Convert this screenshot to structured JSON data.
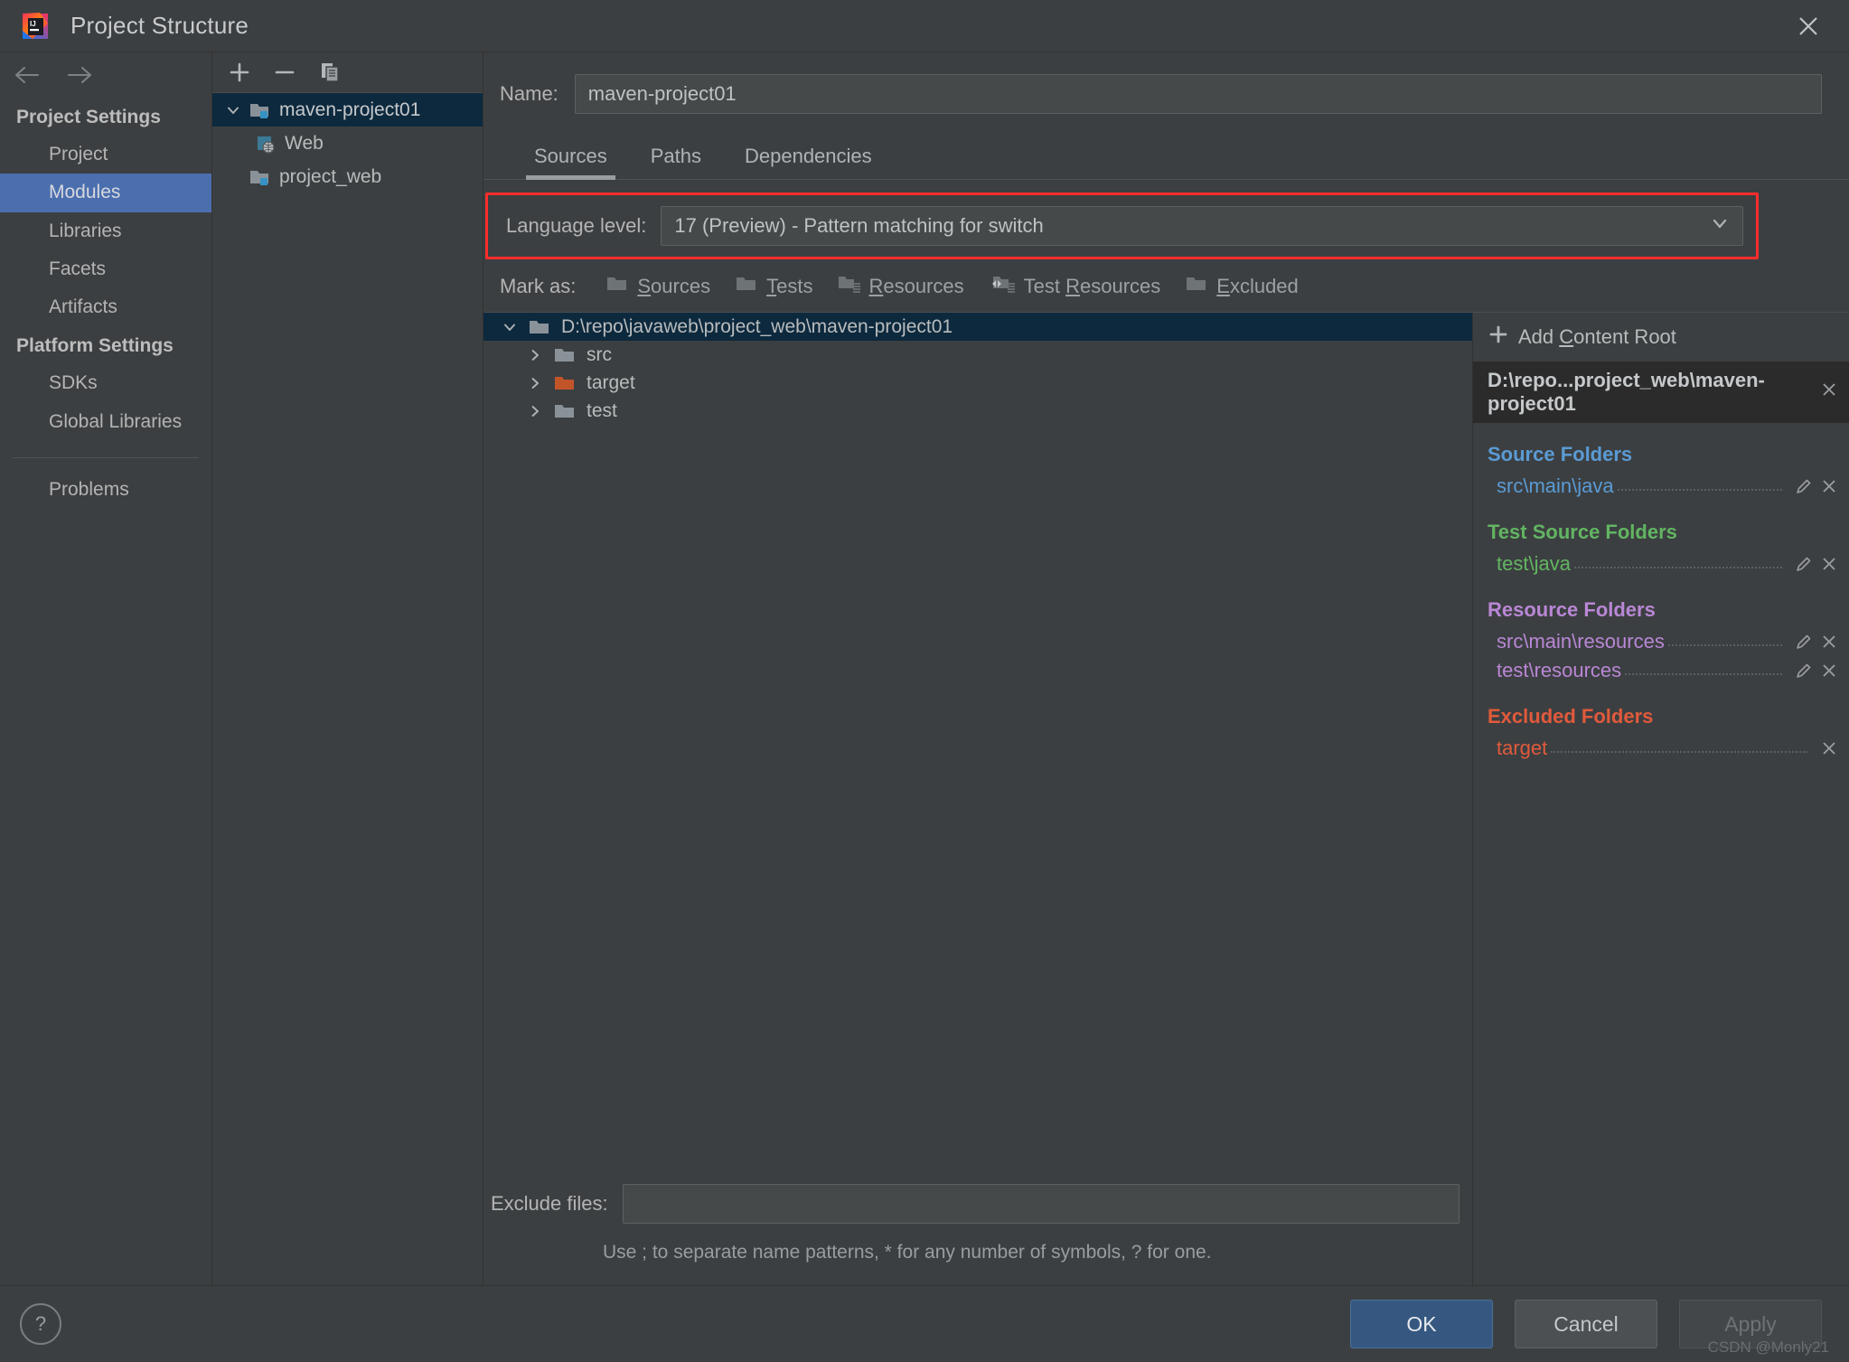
{
  "window": {
    "title": "Project Structure",
    "logo_icon": "intellij-idea-logo",
    "close_icon": "close-icon"
  },
  "sidebar": {
    "back_icon": "arrow-left-icon",
    "forward_icon": "arrow-right-icon",
    "groups": [
      {
        "header": "Project Settings",
        "items": [
          {
            "label": "Project",
            "selected": false
          },
          {
            "label": "Modules",
            "selected": true
          },
          {
            "label": "Libraries",
            "selected": false
          },
          {
            "label": "Facets",
            "selected": false
          },
          {
            "label": "Artifacts",
            "selected": false
          }
        ]
      },
      {
        "header": "Platform Settings",
        "items": [
          {
            "label": "SDKs",
            "selected": false
          },
          {
            "label": "Global Libraries",
            "selected": false
          }
        ]
      }
    ],
    "problems_label": "Problems",
    "selected_color": "#4b6eaf"
  },
  "modules_panel": {
    "toolbar": {
      "add_icon": "plus-icon",
      "remove_icon": "minus-icon",
      "copy_icon": "copy-icon"
    },
    "tree": [
      {
        "label": "maven-project01",
        "icon": "module-folder-icon",
        "level": 0,
        "expanded": true,
        "selected": true
      },
      {
        "label": "Web",
        "icon": "web-facet-icon",
        "level": 1,
        "expanded": null,
        "selected": false
      },
      {
        "label": "project_web",
        "icon": "module-folder-icon",
        "level": 0,
        "expanded": null,
        "selected": false
      }
    ]
  },
  "main": {
    "name_label": "Name:",
    "name_value": "maven-project01",
    "tabs": [
      {
        "label": "Sources",
        "active": true
      },
      {
        "label": "Paths",
        "active": false
      },
      {
        "label": "Dependencies",
        "active": false
      }
    ],
    "language_level": {
      "label": "Language level:",
      "value": "17 (Preview) - Pattern matching for switch",
      "dropdown_icon": "chevron-down-icon",
      "highlight_color": "#ff2d2d"
    },
    "mark_as": {
      "label": "Mark as:",
      "buttons": [
        {
          "pre": "",
          "mnemonic": "S",
          "post": "ources",
          "icon": "sources-folder-icon"
        },
        {
          "pre": "",
          "mnemonic": "T",
          "post": "ests",
          "icon": "tests-folder-icon"
        },
        {
          "pre": "",
          "mnemonic": "R",
          "post": "esources",
          "icon": "resources-folder-icon"
        },
        {
          "pre": "Test ",
          "mnemonic": "R",
          "post": "esources",
          "icon": "test-resources-folder-icon"
        },
        {
          "pre": "",
          "mnemonic": "E",
          "post": "xcluded",
          "icon": "excluded-folder-icon"
        }
      ]
    },
    "source_tree": [
      {
        "label": "D:\\repo\\javaweb\\project_web\\maven-project01",
        "level": 0,
        "expanded": true,
        "selected": true,
        "icon": "folder-icon",
        "color": "normal"
      },
      {
        "label": "src",
        "level": 1,
        "expanded": false,
        "selected": false,
        "icon": "folder-icon",
        "color": "normal"
      },
      {
        "label": "target",
        "level": 1,
        "expanded": false,
        "selected": false,
        "icon": "folder-icon",
        "color": "excluded"
      },
      {
        "label": "test",
        "level": 1,
        "expanded": false,
        "selected": false,
        "icon": "folder-icon",
        "color": "normal"
      }
    ],
    "exclude_files": {
      "label": "Exclude files:",
      "value": "",
      "placeholder": "",
      "hint": "Use ; to separate name patterns, * for any number of symbols, ? for one."
    }
  },
  "folders_pane": {
    "add_content_root": {
      "pre": "Add ",
      "mnemonic": "C",
      "post": "ontent Root",
      "icon": "plus-icon"
    },
    "content_root": {
      "label": "D:\\repo...project_web\\maven-project01",
      "remove_icon": "close-icon"
    },
    "sections": [
      {
        "title": "Source Folders",
        "kind": "source",
        "items": [
          {
            "path": "src\\main\\java",
            "edit_icon": "pencil-icon",
            "remove_icon": "close-icon"
          }
        ]
      },
      {
        "title": "Test Source Folders",
        "kind": "test",
        "items": [
          {
            "path": "test\\java",
            "edit_icon": "pencil-icon",
            "remove_icon": "close-icon"
          }
        ]
      },
      {
        "title": "Resource Folders",
        "kind": "resource",
        "items": [
          {
            "path": "src\\main\\resources",
            "edit_icon": "pencil-icon",
            "remove_icon": "close-icon"
          },
          {
            "path": "test\\resources",
            "edit_icon": "pencil-icon",
            "remove_icon": "close-icon"
          }
        ]
      },
      {
        "title": "Excluded Folders",
        "kind": "excluded",
        "items": [
          {
            "path": "target",
            "edit_icon": null,
            "remove_icon": "close-icon"
          }
        ]
      }
    ]
  },
  "footer": {
    "help_label": "?",
    "ok_label": "OK",
    "cancel_label": "Cancel",
    "apply_label": "Apply",
    "watermark": "CSDN @Monly21"
  }
}
